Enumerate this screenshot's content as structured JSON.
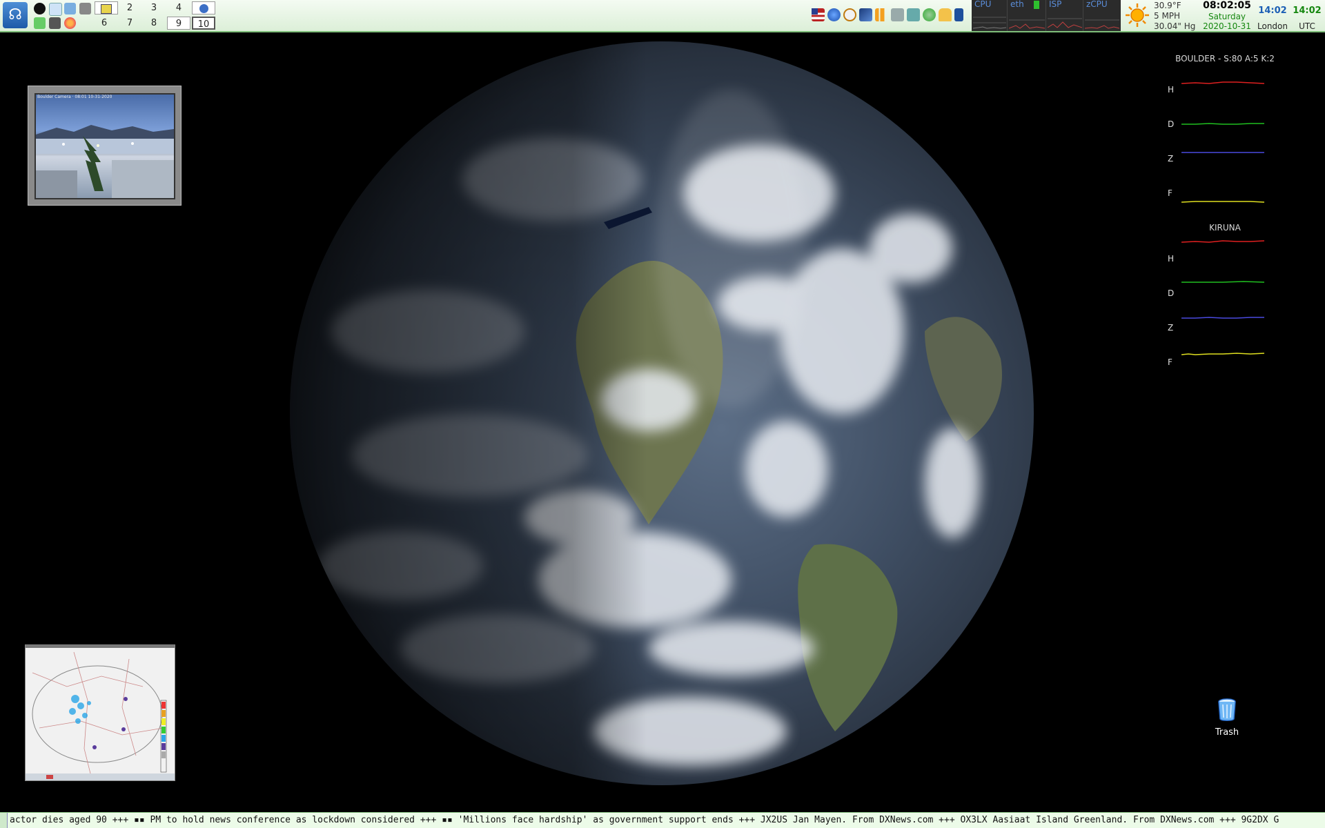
{
  "panel": {
    "start_label": "Start",
    "desktops_top": [
      "2",
      "3",
      "4"
    ],
    "desktops_bottom": [
      "6",
      "7",
      "8",
      "9",
      "10"
    ],
    "monitors": [
      "CPU",
      "eth",
      "ISP",
      "zCPU"
    ],
    "weather": {
      "temp": "30.9°F",
      "wind": "5 MPH",
      "pressure": "30.04\" Hg"
    },
    "clock": {
      "time": "08:02:05",
      "day": "Saturday",
      "date": "2020-10-31",
      "london_time": "14:02",
      "london_label": "London",
      "utc_time": "14:02",
      "utc_label": "UTC"
    },
    "colors": {
      "panel_bg": "#e6f5e2",
      "clock_blue": "#1c5fb5",
      "clock_green": "#15870f"
    }
  },
  "magnetometers": {
    "boulder_title": "BOULDER - S:80 A:5 K:2",
    "kiruna_title": "KIRUNA",
    "rows": [
      "H",
      "D",
      "Z",
      "F"
    ],
    "trace_colors": [
      "#e02020",
      "#20c020",
      "#4a4ae0",
      "#e0e020"
    ]
  },
  "desktop": {
    "trash_label": "Trash",
    "webcam_caption": "Boulder Camera · 08:01 10-31-2020"
  },
  "ticker": {
    "text": "actor dies aged 90 +++ ▪▪ PM to hold news conference as lockdown considered +++ ▪▪ 'Millions face hardship' as government support ends +++ JX2US Jan Mayen. From DXNews.com +++ OX3LX Aasiaat Island Greenland. From DXNews.com +++ 9G2DX G"
  }
}
